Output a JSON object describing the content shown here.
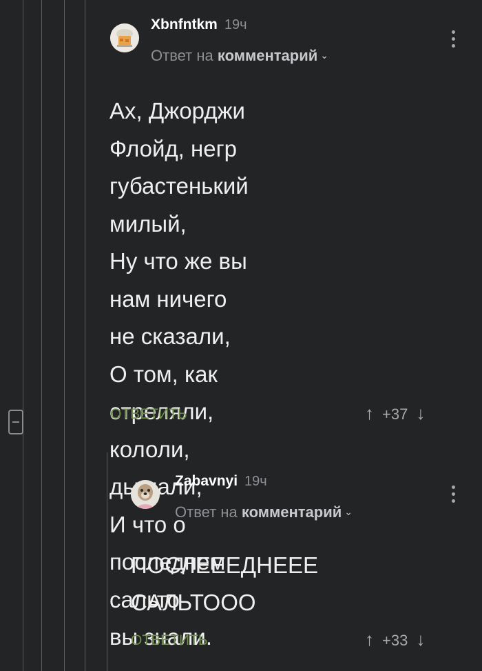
{
  "comment1": {
    "author": "Xbnfntkm",
    "time": "19ч",
    "reply_prefix": "Ответ на",
    "reply_target": "комментарий",
    "chevron": "⌄",
    "text": "Ах, Джорджи Флойд, негр\nгубастенький милый,\nНу что же вы нам ничего\nне сказали,\nО том, как стреляли,\nкололи, дышали,\nИ что о последнем сальто\nвы знали.",
    "reply_label": "ОТВЕТИТЬ",
    "score": "+37",
    "up_icon": "↑",
    "down_icon": "↓"
  },
  "comment2": {
    "author": "Zabavnyi",
    "time": "19ч",
    "reply_prefix": "Ответ на",
    "reply_target": "комментарий",
    "chevron": "⌄",
    "text": "ПОСЛЕЕЕДНЕЕЕ\nСАЛЬТООО",
    "reply_label": "ОТВЕТИТЬ",
    "score": "+33",
    "up_icon": "↑",
    "down_icon": "↓"
  },
  "colors": {
    "background": "#232426",
    "thread_line": "#5c5d60",
    "reply_green": "#6f8f4a",
    "text": "#efefef",
    "muted": "#8e8f93"
  },
  "icons": [
    "collapse-thread-icon",
    "more-vertical-icon",
    "arrow-up-icon",
    "arrow-down-icon",
    "chevron-down-icon"
  ]
}
